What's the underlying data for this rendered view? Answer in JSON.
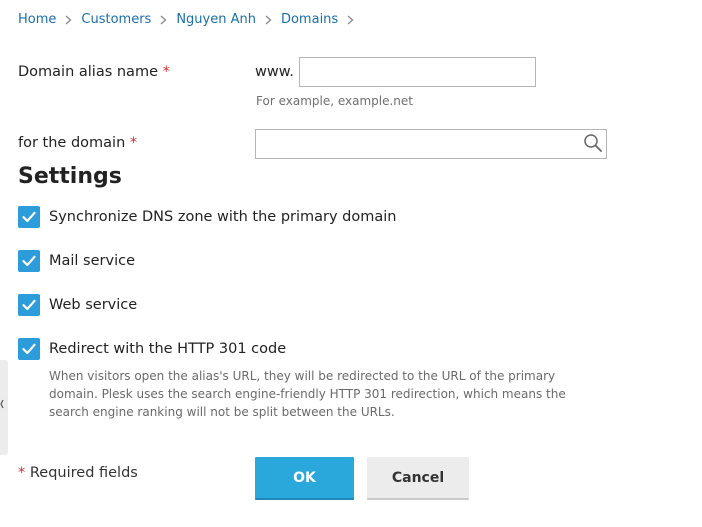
{
  "breadcrumb": {
    "items": [
      "Home",
      "Customers",
      "Nguyen Anh",
      "Domains"
    ]
  },
  "form": {
    "alias_label": "Domain alias name",
    "required_mark": "*",
    "alias_prefix": "www.",
    "alias_value": "",
    "alias_hint": "For example, example.net",
    "domain_label": "for the domain",
    "domain_value": ""
  },
  "settings": {
    "title": "Settings",
    "options": [
      {
        "label": "Synchronize DNS zone with the primary domain",
        "checked": true
      },
      {
        "label": "Mail service",
        "checked": true
      },
      {
        "label": "Web service",
        "checked": true
      },
      {
        "label": "Redirect with the HTTP 301 code",
        "checked": true
      }
    ],
    "redirect_description": "When visitors open the alias's URL, they will be redirected to the URL of the primary domain. Plesk uses the search engine-friendly HTTP 301 redirection, which means the search engine ranking will not be split between the URLs."
  },
  "footer": {
    "required_note": "Required fields",
    "ok_label": "OK",
    "cancel_label": "Cancel"
  },
  "colors": {
    "link": "#1b6fa8",
    "checkbox": "#2d9cdb",
    "primary_button": "#2aa8dc",
    "required": "#d32f2f"
  },
  "icons": {
    "breadcrumb_separator": "chevron-right-icon",
    "domain_search": "search-icon",
    "checkbox": "checkmark-icon",
    "side_panel": "chevron-left-icon"
  }
}
